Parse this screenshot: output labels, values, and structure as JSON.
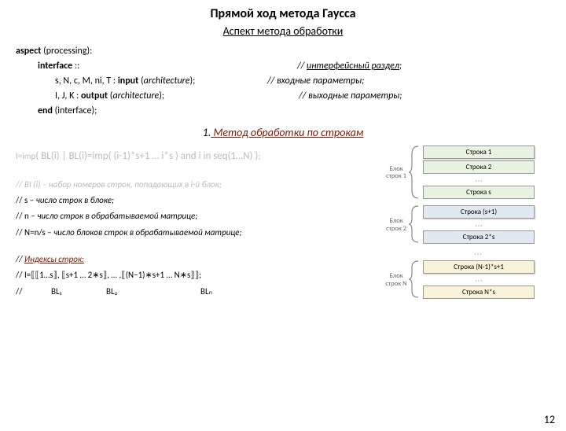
{
  "title": "Прямой ход метода Гаусса",
  "subtitle": "Аспект метода обработки",
  "aspect_line": {
    "kw": "aspect",
    "rest": " (processing):"
  },
  "iface_line": {
    "kw": "interface",
    "rest": " ::",
    "comment_pre": "// ",
    "comment_u": "интерфейсный раздел",
    "comment_post": ";"
  },
  "input_line": {
    "params": "s, N, c, M, ni, T : ",
    "kw": "input",
    "rest_open": " (",
    "rest_it": "architecture",
    "rest_close": ");",
    "comment": "// входные параметры;"
  },
  "output_line": {
    "params": "I, J, K : ",
    "kw": "output",
    "rest_open": " (",
    "rest_it": "architecture",
    "rest_close": ");",
    "comment": "// выходные параметры;"
  },
  "end_line": {
    "kw": "end",
    "rest": " (interface);"
  },
  "section_num": "1.",
  "section_title": "Метод обработки по строкам",
  "imp_line": {
    "pre": "I=imp",
    "body": "( BL(i) | BL(i)=imp( (i-1)*s+1 … i*s ) and i in seq(1…N) )",
    "post": ";"
  },
  "note1_full": "// BI (i) – набор номеров строк, попадающих в i-й блок;",
  "note1_pre": "// BI (i) – ",
  "note1_it": "набор номеров строк, попадающих в i-й блок;",
  "note2_pre": "// s – ",
  "note2_it": "число строк в блоке;",
  "note3_pre": "// n – ",
  "note3_it": "число строк в обрабатываемой матрице;",
  "note4_pre": "// N=n/s – ",
  "note4_it": "число блоков строк в обрабатываемой матрице;",
  "idx_pre": "// ",
  "idx_u": "Индексы строк:",
  "idx_line": "// I=⟦⟦1…s⟧, ⟦s+1 … 2∗s⟧, … ,⟦(N−1)∗s+1 … N∗s⟧⟧;",
  "bl_slash": "//",
  "bl1": "BL₁",
  "bl2": "BL₂",
  "bln": "BLₙ",
  "diagram": {
    "b1": {
      "label1": "Блок",
      "label2": "строк 1",
      "rows": [
        "Строка 1",
        "Строка 2",
        "Строка s"
      ]
    },
    "b2": {
      "label1": "Блок",
      "label2": "строк 2",
      "rows": [
        "Строка (s+1)",
        "Строка 2*s"
      ]
    },
    "bn": {
      "label1": "Блок",
      "label2": "строк N",
      "rows": [
        "Строка (N-1)*s+1",
        "Строка N*s"
      ]
    }
  },
  "pagenum": "12"
}
